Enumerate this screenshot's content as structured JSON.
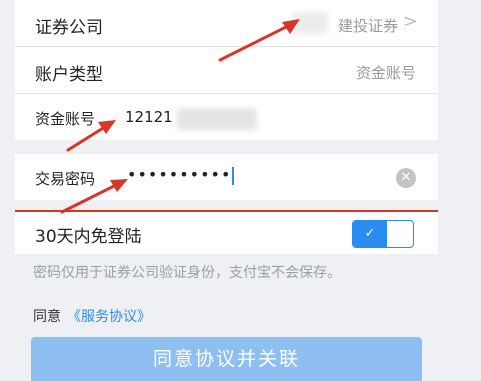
{
  "form": {
    "broker": {
      "label": "证券公司",
      "value": "建投证券",
      "chevron": ">"
    },
    "account_type": {
      "label": "账户类型",
      "value": "资金账号"
    },
    "account_number": {
      "label": "资金账号",
      "value": "12121"
    },
    "password": {
      "label": "交易密码",
      "masked": "••••••••••"
    }
  },
  "auto_login": {
    "label": "30天内免登陆",
    "enabled": true,
    "check": "✓"
  },
  "note": "密码仅用于证券公司验证身份，支付宝不会保存。",
  "agreement": {
    "prefix": "同意",
    "link": "《服务协议》"
  },
  "submit_label": "同意协议并关联",
  "annotation_color": "#d8342c",
  "accent_color": "#2b8cf0"
}
